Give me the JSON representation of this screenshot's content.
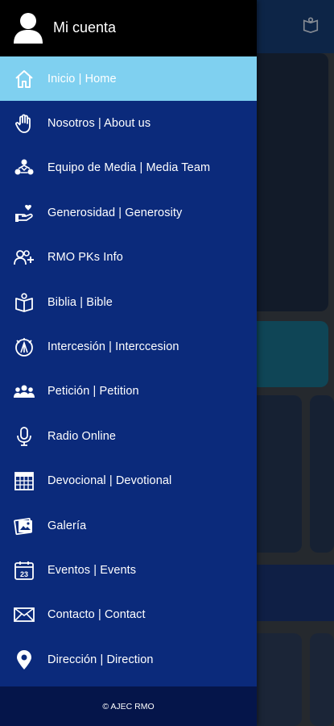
{
  "account": {
    "label": "Mi cuenta"
  },
  "menu": {
    "items": [
      {
        "label": "Inicio | Home",
        "icon": "home-icon",
        "active": true
      },
      {
        "label": "Nosotros | About us",
        "icon": "hand-icon"
      },
      {
        "label": "Equipo de Media | Media Team",
        "icon": "team-icon"
      },
      {
        "label": "Generosidad | Generosity",
        "icon": "giving-hand-icon"
      },
      {
        "label": "RMO PKs Info",
        "icon": "add-user-icon"
      },
      {
        "label": "Biblia | Bible",
        "icon": "bible-icon"
      },
      {
        "label": "Intercesión | Interccesion",
        "icon": "praying-hands-icon"
      },
      {
        "label": "Petición | Petition",
        "icon": "group-icon"
      },
      {
        "label": "Radio Online",
        "icon": "microphone-icon"
      },
      {
        "label": "Devocional | Devotional",
        "icon": "calendar-grid-icon"
      },
      {
        "label": "Galería",
        "icon": "gallery-icon"
      },
      {
        "label": "Eventos | Events",
        "icon": "calendar-icon"
      },
      {
        "label": "Contacto | Contact",
        "icon": "mail-icon"
      },
      {
        "label": "Dirección | Direction",
        "icon": "location-pin-icon"
      }
    ]
  },
  "footer": {
    "text": "© AJEC RMO"
  },
  "colors": {
    "drawer": "#0b2a7b",
    "active": "#7fd0f0",
    "header": "#000000",
    "footer": "#05154a"
  }
}
